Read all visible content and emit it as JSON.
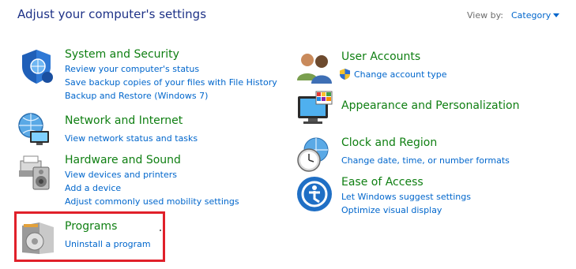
{
  "header": {
    "title": "Adjust your computer's settings",
    "view_by_label": "View by:",
    "view_by_value": "Category"
  },
  "left": {
    "system_security": {
      "title": "System and Security",
      "links": [
        "Review your computer's status",
        "Save backup copies of your files with File History",
        "Backup and Restore (Windows 7)"
      ]
    },
    "network": {
      "title": "Network and Internet",
      "links": [
        "View network status and tasks"
      ]
    },
    "hardware": {
      "title": "Hardware and Sound",
      "links": [
        "View devices and printers",
        "Add a device",
        "Adjust commonly used mobility settings"
      ]
    },
    "programs": {
      "title": "Programs",
      "links": [
        "Uninstall a program"
      ]
    }
  },
  "right": {
    "user_accounts": {
      "title": "User Accounts",
      "links": [
        "Change account type"
      ]
    },
    "appearance": {
      "title": "Appearance and Personalization",
      "links": []
    },
    "clock": {
      "title": "Clock and Region",
      "links": [
        "Change date, time, or number formats"
      ]
    },
    "ease": {
      "title": "Ease of Access",
      "links": [
        "Let Windows suggest settings",
        "Optimize visual display"
      ]
    }
  },
  "colors": {
    "header_text": "#1e3287",
    "category_title": "#0f7f12",
    "link": "#0066cc",
    "highlight_border": "#e0202a"
  }
}
